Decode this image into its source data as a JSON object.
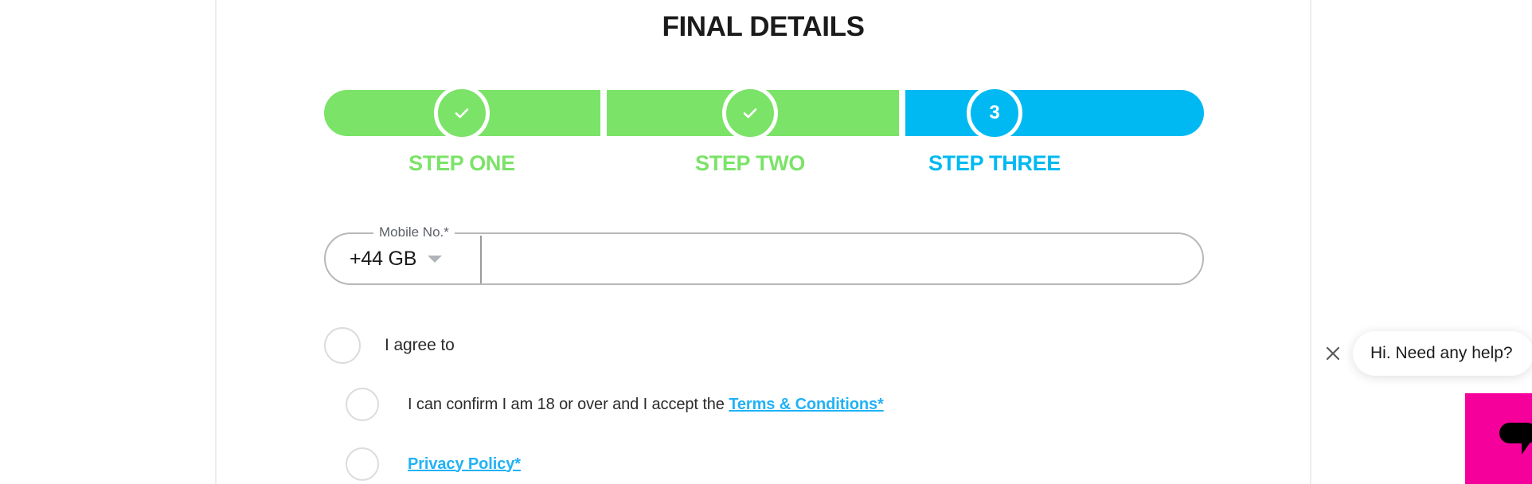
{
  "form": {
    "title": "FINAL DETAILS"
  },
  "stepper": {
    "steps": [
      {
        "label": "STEP ONE",
        "marker": "check",
        "state": "complete",
        "color": "#7BE368"
      },
      {
        "label": "STEP TWO",
        "marker": "check",
        "state": "complete",
        "color": "#7BE368"
      },
      {
        "label": "STEP THREE",
        "marker": "3",
        "state": "current",
        "color": "#00B9F2"
      }
    ],
    "complete_color": "#7BE368",
    "current_color": "#00B9F2",
    "check_icon": "check-icon"
  },
  "mobile": {
    "legend": "Mobile No.*",
    "country_code": "+44 GB",
    "caret_icon": "chevron-down-icon",
    "phone_value": "",
    "phone_placeholder": ""
  },
  "consents": [
    {
      "id": "agree-to",
      "text_before": "I agree to",
      "link": "",
      "text_after": "",
      "checked": false
    },
    {
      "id": "age-and-terms",
      "text_before": "I can confirm I am 18 or over and I accept the ",
      "link": "Terms & Conditions*",
      "text_after": "",
      "checked": false
    },
    {
      "id": "privacy-policy",
      "text_before": "",
      "link": "Privacy Policy*",
      "text_after": "",
      "checked": false
    }
  ],
  "chat": {
    "prompt": "Hi. Need any help?",
    "close_icon": "close-icon",
    "launcher_icon": "chat-bubble-icon",
    "launcher_color": "#F6009B"
  }
}
